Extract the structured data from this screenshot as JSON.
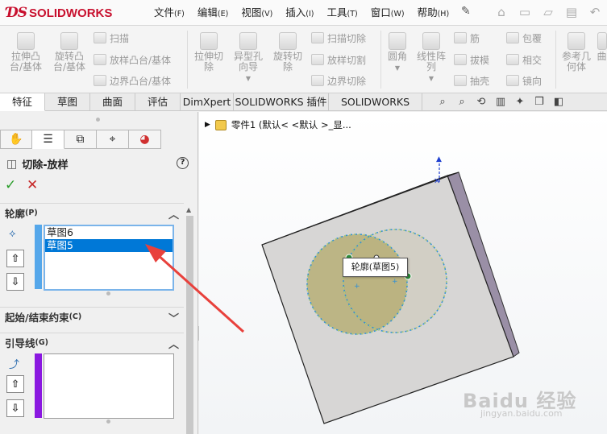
{
  "app": {
    "logo_text": "SOLIDWORKS"
  },
  "menu": [
    {
      "label": "文件",
      "key": "(F)"
    },
    {
      "label": "编辑",
      "key": "(E)"
    },
    {
      "label": "视图",
      "key": "(V)"
    },
    {
      "label": "插入",
      "key": "(I)"
    },
    {
      "label": "工具",
      "key": "(T)"
    },
    {
      "label": "窗口",
      "key": "(W)"
    },
    {
      "label": "帮助",
      "key": "(H)"
    }
  ],
  "ribbon": {
    "extrude_boss": "拉伸凸\n台/基体",
    "revolve_boss": "旋转凸\n台/基体",
    "sweep": "扫描",
    "loft_boss": "放样凸台/基体",
    "boundary_boss": "边界凸台/基体",
    "extrude_cut": "拉伸切\n除",
    "hole_wizard": "异型孔\n向导",
    "revolve_cut": "旋转切\n除",
    "sweep_cut": "扫描切除",
    "loft_cut": "放样切割",
    "boundary_cut": "边界切除",
    "fillet": "圆角",
    "linear_pattern": "线性阵\n列",
    "rib": "筋",
    "draft": "拔模",
    "shell": "抽壳",
    "wrap": "包覆",
    "intersect": "相交",
    "mirror": "镜向",
    "reference_geometry": "参考几\n何体",
    "curves": "曲"
  },
  "tabs": [
    "特征",
    "草图",
    "曲面",
    "评估",
    "DimXpert",
    "SOLIDWORKS 插件",
    "SOLIDWORKS MBD"
  ],
  "panel": {
    "feature_title": "切除-放样",
    "ok": "✓",
    "cancel": "✕",
    "profiles": {
      "title": "轮廓",
      "key": "(P)",
      "items": [
        "草图6",
        "草图5"
      ],
      "selected_index": 1
    },
    "start_end": {
      "title": "起始/结束约束",
      "key": "(C)"
    },
    "guides": {
      "title": "引导线",
      "key": "(G)"
    },
    "help": "?"
  },
  "tree": {
    "label": "零件1  (默认< <默认 >_显..."
  },
  "tooltip": {
    "label": "轮廓(草图5)"
  },
  "watermark": {
    "brand": "Baidu 经验",
    "url": "jingyan.baidu.com"
  },
  "colors": {
    "brand_red": "#c8102e",
    "selection_blue": "#0078d7",
    "listbox_border": "#7ab4ea",
    "profile_stripe": "#55a7ea",
    "guide_stripe": "#8a18e0",
    "annotation_arrow": "#e8413c",
    "sketch_dash": "#2f8fd6",
    "loft_fill": "#b3a96a"
  }
}
